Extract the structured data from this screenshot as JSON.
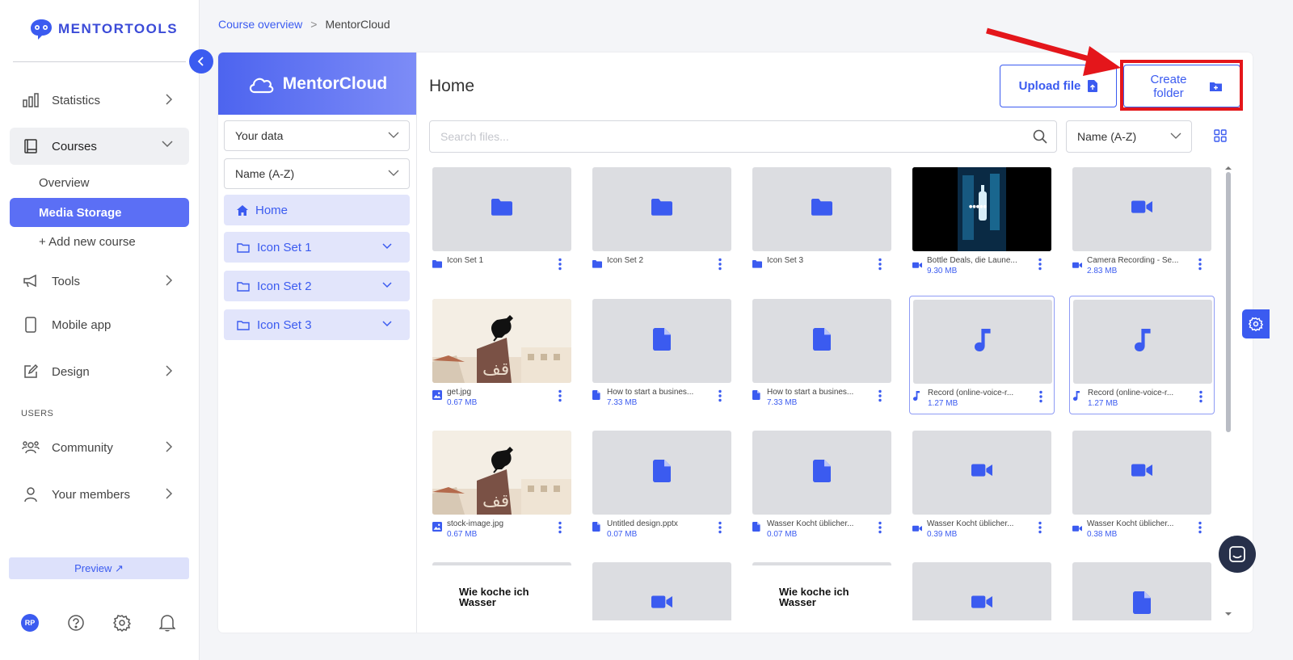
{
  "brand": {
    "name": "MENTORTOOLS",
    "accent": "#3b5bf0",
    "highlight": "#e4161b"
  },
  "sidebar": {
    "items": [
      {
        "label": "Statistics",
        "icon": "bar-chart-icon"
      },
      {
        "label": "Courses",
        "icon": "book-icon"
      },
      {
        "label": "Tools",
        "icon": "megaphone-icon"
      },
      {
        "label": "Mobile app",
        "icon": "phone-icon"
      },
      {
        "label": "Design",
        "icon": "pen-icon"
      }
    ],
    "sub_items": [
      {
        "label": "Overview"
      },
      {
        "label": "Media Storage"
      },
      {
        "label": "+ Add new course"
      }
    ],
    "users_section_label": "USERS",
    "users_items": [
      {
        "label": "Community",
        "icon": "community-icon"
      },
      {
        "label": "Your members",
        "icon": "person-icon"
      }
    ],
    "preview_label": "Preview ↗",
    "avatar_initials": "RP"
  },
  "breadcrumb": {
    "parent": "Course overview",
    "separator": ">",
    "current": "MentorCloud"
  },
  "cloud": {
    "title": "MentorCloud",
    "data_select": "Your data",
    "sort_select": "Name (A-Z)",
    "tree": [
      {
        "label": "Home",
        "icon": "home-icon"
      },
      {
        "label": "Icon Set 1",
        "icon": "folder-outline-icon"
      },
      {
        "label": "Icon Set 2",
        "icon": "folder-outline-icon"
      },
      {
        "label": "Icon Set 3",
        "icon": "folder-outline-icon"
      }
    ]
  },
  "main": {
    "title": "Home",
    "upload_label": "Upload file",
    "create_label": "Create folder",
    "search_placeholder": "Search files...",
    "sort_label": "Name (A-Z)"
  },
  "files": [
    {
      "name": "Icon Set 1",
      "size": "",
      "type": "folder",
      "thumb": "folder"
    },
    {
      "name": "Icon Set 2",
      "size": "",
      "type": "folder",
      "thumb": "folder"
    },
    {
      "name": "Icon Set 3",
      "size": "",
      "type": "folder",
      "thumb": "folder"
    },
    {
      "name": "Bottle Deals, die Laune...",
      "size": "9.30 MB",
      "type": "video",
      "thumb": "dark"
    },
    {
      "name": "Camera Recording - Se...",
      "size": "2.83 MB",
      "type": "video",
      "thumb": "video"
    },
    {
      "name": "get.jpg",
      "size": "0.67 MB",
      "type": "image",
      "thumb": "photo"
    },
    {
      "name": "How to start a busines...",
      "size": "7.33 MB",
      "type": "doc",
      "thumb": "doc"
    },
    {
      "name": "How to start a busines...",
      "size": "7.33 MB",
      "type": "doc",
      "thumb": "doc"
    },
    {
      "name": "Record (online-voice-r...",
      "size": "1.27 MB",
      "type": "audio",
      "thumb": "audio"
    },
    {
      "name": "Record (online-voice-r...",
      "size": "1.27 MB",
      "type": "audio",
      "thumb": "audio"
    },
    {
      "name": "stock-image.jpg",
      "size": "0.67 MB",
      "type": "image",
      "thumb": "photo"
    },
    {
      "name": "Untitled design.pptx",
      "size": "0.07 MB",
      "type": "doc",
      "thumb": "doc"
    },
    {
      "name": "Wasser Kocht üblicher...",
      "size": "0.07 MB",
      "type": "doc",
      "thumb": "doc"
    },
    {
      "name": "Wasser Kocht üblicher...",
      "size": "0.39 MB",
      "type": "video",
      "thumb": "video"
    },
    {
      "name": "Wasser Kocht üblicher...",
      "size": "0.38 MB",
      "type": "video",
      "thumb": "video"
    },
    {
      "name": "",
      "size": "",
      "type": "doc",
      "thumb": "text",
      "thumb_text": "Wie koche ich Wasser"
    },
    {
      "name": "",
      "size": "",
      "type": "video",
      "thumb": "video"
    },
    {
      "name": "",
      "size": "",
      "type": "doc",
      "thumb": "text",
      "thumb_text": "Wie koche ich Wasser"
    },
    {
      "name": "",
      "size": "",
      "type": "video",
      "thumb": "video"
    },
    {
      "name": "",
      "size": "",
      "type": "doc",
      "thumb": "doc"
    }
  ]
}
